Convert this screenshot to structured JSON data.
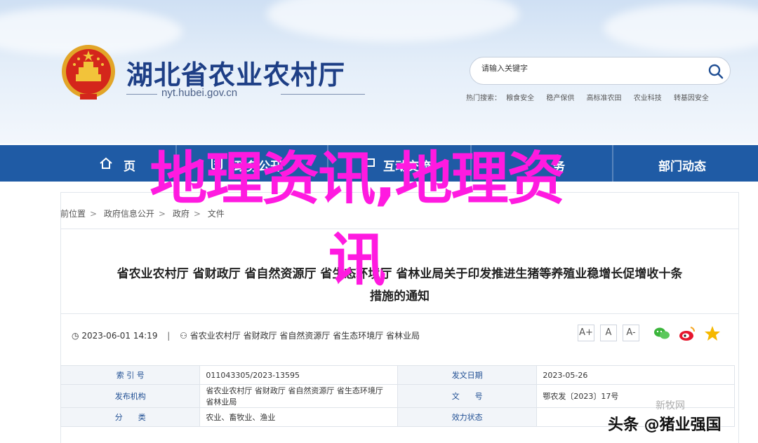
{
  "site": {
    "title": "湖北省农业农村厅",
    "domain": "nyt.hubei.gov.cn"
  },
  "search": {
    "placeholder": "请输入关键字",
    "hot_label": "热门搜索：",
    "hot_terms": [
      "粮食安全",
      "稳产保供",
      "高标准农田",
      "农业科技",
      "转基因安全"
    ]
  },
  "nav": {
    "items": [
      "首页",
      "政务公开",
      "互动交流",
      "政务服务",
      "部门动态"
    ],
    "partial_visible": [
      "页",
      "政务公开",
      "互动交流",
      "务",
      "部门动态"
    ]
  },
  "breadcrumb": {
    "items": [
      "前位置",
      "政府信息公开",
      "政府",
      "文件"
    ]
  },
  "article": {
    "title": "省农业农村厅 省财政厅 省自然资源厅 省生态环境厅 省林业局关于印发推进生猪等养殖业稳增长促增收十条措施的通知",
    "title_line1": "省农业农村厅 省财政厅 省自然资源厅 省生态环境厅 省林业局关于印发推进生猪等养殖业稳增长促增收十条",
    "title_line2": "措施的通知",
    "date": "2023-06-01 14:19",
    "pipe": "|",
    "sources": "省农业农村厅 省财政厅 省自然资源厅 省生态环境厅 省林业局",
    "font_sizes": [
      "A+",
      "A",
      "A-"
    ]
  },
  "info_table": {
    "rows": [
      {
        "k1": "索 引 号",
        "v1": "011043305/2023-13595",
        "k2": "发文日期",
        "v2": "2023-05-26"
      },
      {
        "k1": "发布机构",
        "v1": "省农业农村厅 省财政厅 省自然资源厅 省生态环境厅 省林业局",
        "k2": "文　　号",
        "v2": "鄂农发〔2023〕17号"
      },
      {
        "k1": "分　　类",
        "v1": "农业、畜牧业、渔业",
        "k2": "效力状态",
        "v2": ""
      }
    ]
  },
  "overlay": {
    "line1": "地理资讯,地理资",
    "line2": "讯"
  },
  "watermarks": {
    "faint": "新牧网",
    "credit": "头条 @猪业强国"
  },
  "colors": {
    "nav_bg": "#1f5ba5",
    "title": "#1e3f86",
    "overlay": "#ff1ae0",
    "key_cell": "#1f4e93"
  }
}
